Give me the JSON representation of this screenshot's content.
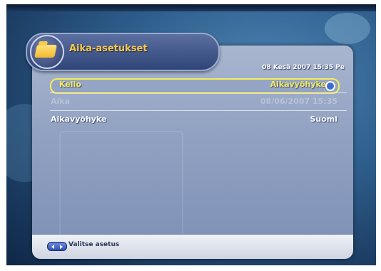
{
  "menu": {
    "title": "Aika-asetukset",
    "datetime": "08 Kesä 2007 15:35 Pe",
    "rows": [
      {
        "label": "Kello",
        "value": "Aikavyöhyke",
        "selected": true,
        "enabled": true
      },
      {
        "label": "Aika",
        "value": "08/06/2007 15:35",
        "selected": false,
        "enabled": false
      },
      {
        "label": "Aikavyöhyke",
        "value": "Suomi",
        "selected": false,
        "enabled": true
      }
    ]
  },
  "footer": {
    "hint": "Valitse asetus",
    "hint_icon": "left-right-arrows-icon"
  },
  "icons": {
    "title_icon": "folder-icon",
    "row_icon": "gear-icon"
  },
  "colors": {
    "title": "#f6c84b",
    "highlight": "#f3ec5a",
    "panel": "#92a2c2"
  }
}
